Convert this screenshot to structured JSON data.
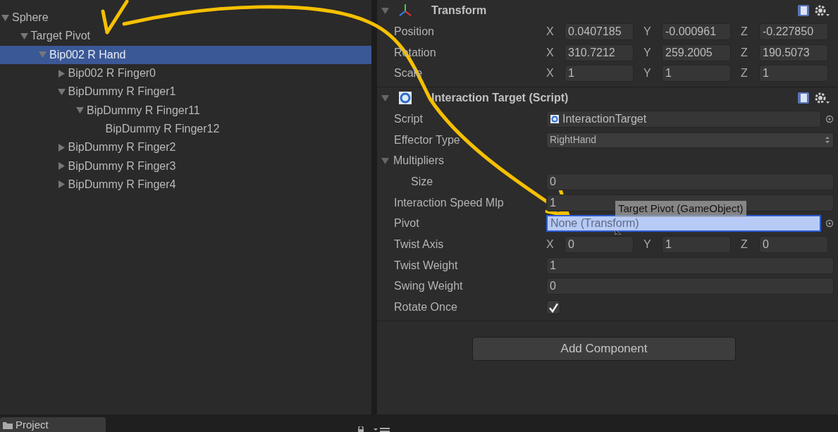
{
  "hierarchy": {
    "items": [
      {
        "label": "Sphere",
        "expanded": true,
        "selected": false,
        "children": [
          {
            "label": "Target Pivot",
            "expanded": true,
            "selected": false,
            "children": [
              {
                "label": "Bip002 R Hand",
                "expanded": true,
                "selected": true,
                "children": [
                  {
                    "label": "Bip002 R Finger0",
                    "expanded": false,
                    "selected": false
                  },
                  {
                    "label": "BipDummy R Finger1",
                    "expanded": true,
                    "selected": false,
                    "children": [
                      {
                        "label": "BipDummy R Finger11",
                        "expanded": true,
                        "selected": false,
                        "children": [
                          {
                            "label": "BipDummy R Finger12",
                            "selected": false
                          }
                        ]
                      }
                    ]
                  },
                  {
                    "label": "BipDummy R Finger2",
                    "expanded": false,
                    "selected": false
                  },
                  {
                    "label": "BipDummy R Finger3",
                    "expanded": false,
                    "selected": false
                  },
                  {
                    "label": "BipDummy R Finger4",
                    "expanded": false,
                    "selected": false
                  }
                ]
              }
            ]
          }
        ]
      }
    ]
  },
  "inspector": {
    "components": [
      {
        "title": "Transform",
        "kind": "transform",
        "expanded": true,
        "rows": [
          {
            "label": "Position",
            "kind": "vector",
            "values": [
              {
                "axis": "X",
                "value": "0.0407185"
              },
              {
                "axis": "Y",
                "value": "-0.000961"
              },
              {
                "axis": "Z",
                "value": "-0.227850"
              }
            ]
          },
          {
            "label": "Rotation",
            "kind": "vector",
            "values": [
              {
                "axis": "X",
                "value": "310.7212"
              },
              {
                "axis": "Y",
                "value": "259.2005"
              },
              {
                "axis": "Z",
                "value": "190.5073"
              }
            ]
          },
          {
            "label": "Scale",
            "kind": "vector",
            "values": [
              {
                "axis": "X",
                "value": "1"
              },
              {
                "axis": "Y",
                "value": "1"
              },
              {
                "axis": "Z",
                "value": "1"
              }
            ]
          }
        ]
      },
      {
        "title": "Interaction Target (Script)",
        "kind": "script",
        "expanded": true,
        "rows": [
          {
            "label": "Script",
            "kind": "script",
            "value": "InteractionTarget"
          },
          {
            "label": "Effector Type",
            "kind": "dropdown",
            "value": "RightHand"
          },
          {
            "label": "Multipliers",
            "kind": "foldout",
            "expanded": true
          },
          {
            "label": "Size",
            "kind": "number",
            "indented": true,
            "value": "0"
          },
          {
            "label": "Interaction Speed Mlp",
            "kind": "number",
            "value": "1"
          },
          {
            "label": "Pivot",
            "kind": "object",
            "value": "None (Transform)",
            "highlighted": true
          },
          {
            "label": "Twist Axis",
            "kind": "vector",
            "values": [
              {
                "axis": "X",
                "value": "0"
              },
              {
                "axis": "Y",
                "value": "1"
              },
              {
                "axis": "Z",
                "value": "0"
              }
            ]
          },
          {
            "label": "Twist Weight",
            "kind": "number",
            "value": "1"
          },
          {
            "label": "Swing Weight",
            "kind": "number",
            "value": "0"
          },
          {
            "label": "Rotate Once",
            "kind": "checkbox",
            "checked": true
          }
        ]
      }
    ],
    "add_button": "Add Component"
  },
  "drag_label": "Target Pivot (GameObject)",
  "bottom_tab": {
    "label": "Project"
  }
}
